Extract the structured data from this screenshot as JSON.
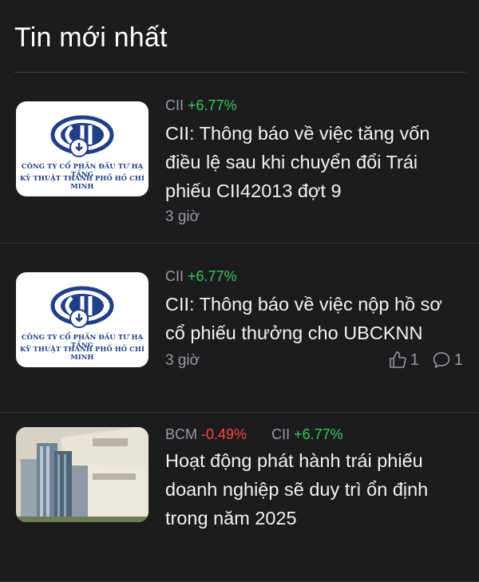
{
  "section": {
    "title": "Tin mới nhất"
  },
  "news": [
    {
      "tags": [
        {
          "ticker": "CII",
          "change": "+6.77%",
          "direction": "up"
        }
      ],
      "headline": "CII: Thông báo về việc tăng vốn điều lệ sau khi chuyển đổi Trái phiếu CII42013 đợt 9",
      "time": "3 giờ",
      "logo": {
        "line1": "CÔNG TY CỔ PHẦN ĐẦU TƯ HẠ TẦNG",
        "line2": "KỸ THUẬT THÀNH PHỐ HỒ CHÍ MINH"
      }
    },
    {
      "tags": [
        {
          "ticker": "CII",
          "change": "+6.77%",
          "direction": "up"
        }
      ],
      "headline": "CII: Thông báo về việc nộp hồ sơ cổ phiếu thưởng cho UBCKNN",
      "time": "3 giờ",
      "likes": "1",
      "comments": "1",
      "logo": {
        "line1": "CÔNG TY CỔ PHẦN ĐẦU TƯ HẠ TẦNG",
        "line2": "KỸ THUẬT THÀNH PHỐ HỒ CHÍ MINH"
      }
    },
    {
      "tags": [
        {
          "ticker": "BCM",
          "change": "-0.49%",
          "direction": "down"
        },
        {
          "ticker": "CII",
          "change": "+6.77%",
          "direction": "up"
        }
      ],
      "headline": "Hoạt động phát hành trái phiếu doanh nghiệp sẽ duy trì ổn định trong năm 2025"
    }
  ],
  "colors": {
    "background": "#1c1c1e",
    "up": "#34c759",
    "down": "#ff453a",
    "muted": "#9a9a9e"
  },
  "icons": {
    "like": "thumbs-up-icon",
    "comment": "comment-icon"
  }
}
